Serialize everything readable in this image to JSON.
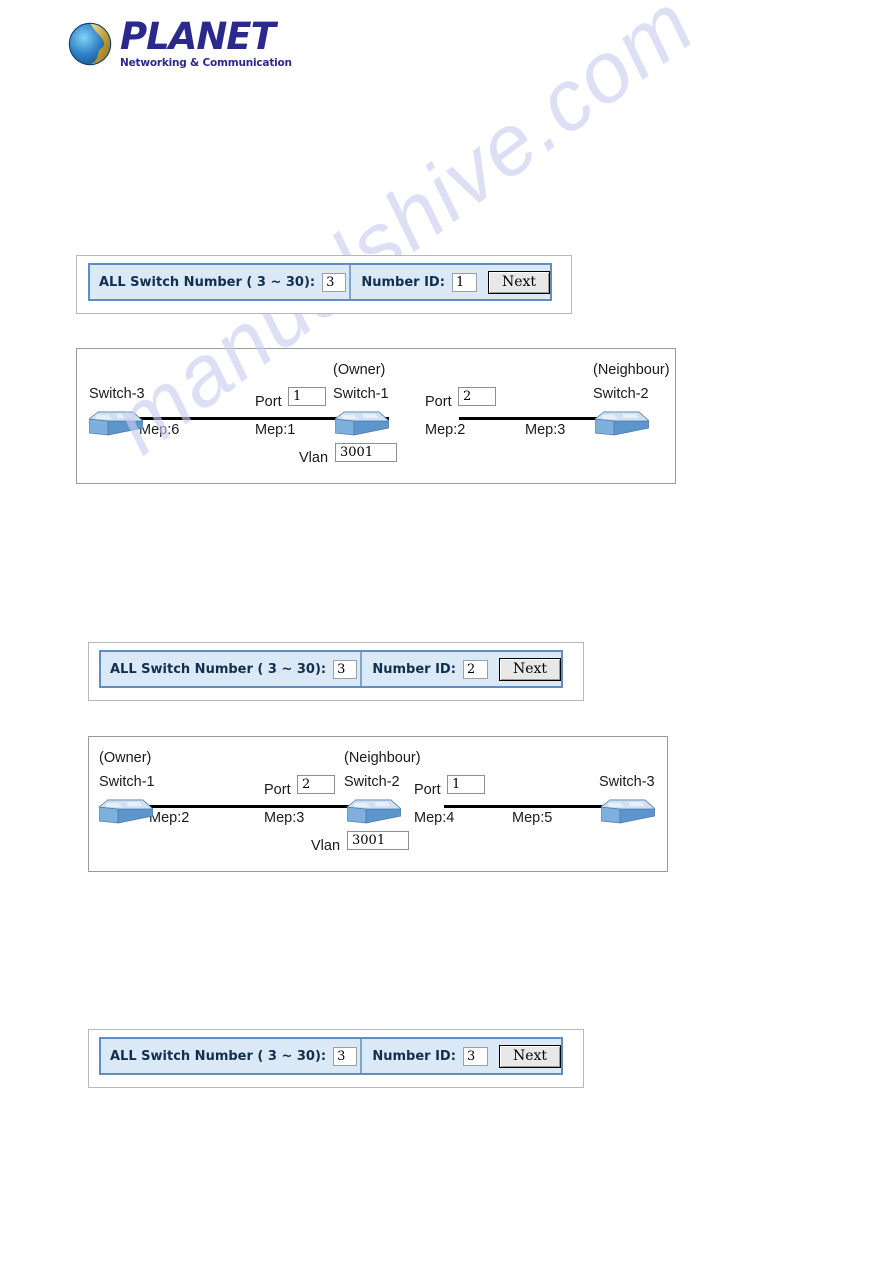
{
  "logo": {
    "brand": "PLANET",
    "tagline": "Networking & Communication",
    "globe_icon": "planet-globe-icon",
    "brand_color": "#2b2a8c"
  },
  "watermark": {
    "text": "manualshive.com",
    "color": "#c9cdf0"
  },
  "forms": [
    {
      "switch_number_label": "ALL Switch Number ( 3 ~ 30):",
      "switch_number_value": "3",
      "number_id_label": "Number ID:",
      "number_id_value": "1",
      "next_label": "Next"
    },
    {
      "switch_number_label": "ALL Switch Number ( 3 ~ 30):",
      "switch_number_value": "3",
      "number_id_label": "Number ID:",
      "number_id_value": "2",
      "next_label": "Next"
    },
    {
      "switch_number_label": "ALL Switch Number ( 3 ~ 30):",
      "switch_number_value": "3",
      "number_id_label": "Number ID:",
      "number_id_value": "3",
      "next_label": "Next"
    }
  ],
  "diagrams": [
    {
      "id": "diagram-1",
      "nodes": [
        {
          "role": "",
          "name": "Switch-3",
          "icon": "network-switch-icon"
        },
        {
          "role": "(Owner)",
          "name": "Switch-1",
          "icon": "network-switch-icon"
        },
        {
          "role": "(Neighbour)",
          "name": "Switch-2",
          "icon": "network-switch-icon"
        }
      ],
      "meps": [
        "Mep:6",
        "Mep:1",
        "Mep:2",
        "Mep:3"
      ],
      "port_label_left": "Port",
      "port_value_left": "1",
      "port_label_right": "Port",
      "port_value_right": "2",
      "vlan_label": "Vlan",
      "vlan_value": "3001"
    },
    {
      "id": "diagram-2",
      "nodes": [
        {
          "role": "(Owner)",
          "name": "Switch-1",
          "icon": "network-switch-icon"
        },
        {
          "role": "(Neighbour)",
          "name": "Switch-2",
          "icon": "network-switch-icon"
        },
        {
          "role": "",
          "name": "Switch-3",
          "icon": "network-switch-icon"
        }
      ],
      "meps": [
        "Mep:2",
        "Mep:3",
        "Mep:4",
        "Mep:5"
      ],
      "port_label_left": "Port",
      "port_value_left": "2",
      "port_label_right": "Port",
      "port_value_right": "1",
      "vlan_label": "Vlan",
      "vlan_value": "3001"
    }
  ]
}
